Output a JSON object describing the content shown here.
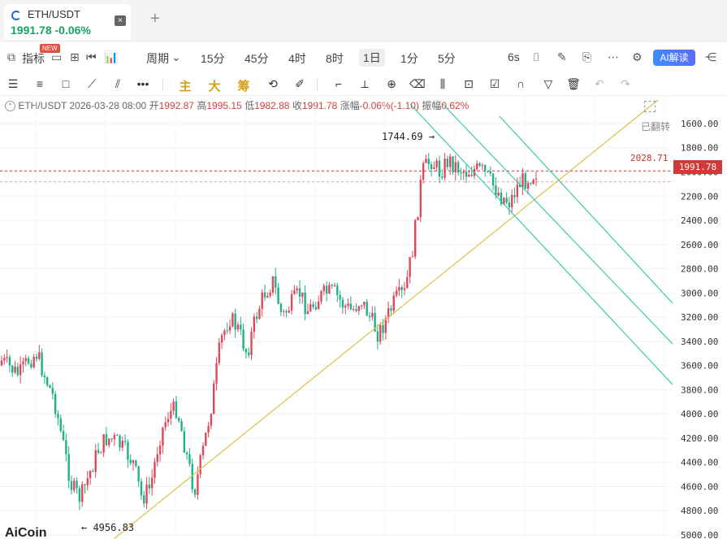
{
  "tab": {
    "symbol": "ETH/USDT",
    "price_change": "1991.78 -0.06%",
    "close": "×",
    "add": "+"
  },
  "period_bar": {
    "indicators": "指标",
    "new_badge": "NEW",
    "period": "周期",
    "intervals": [
      "15分",
      "45分",
      "4时",
      "8时",
      "1日",
      "1分",
      "5分"
    ],
    "active": "1日",
    "refresh": "6s",
    "ai": "AI解读"
  },
  "draw_bar": {
    "main": "主",
    "big": "大",
    "chips": "筹"
  },
  "info": {
    "symbol": "ETH/USDT",
    "datetime": "2026-03-28 08:00",
    "open_label": "开",
    "open": "1992.87",
    "high_label": "高",
    "high": "1995.15",
    "low_label": "低",
    "low": "1982.88",
    "close_label": "收",
    "close": "1991.78",
    "change_label": "涨幅",
    "change": "-0.06%(-1.10)",
    "amp_label": "振幅",
    "amp": "0.62%"
  },
  "chart": {
    "flip_label": "已翻转",
    "current_price": "1991.78",
    "ref_price": "2028.71",
    "top_annotation": "1744.69 →",
    "low_annotation": "← 4956.83",
    "brand": "AiCoin",
    "colors": {
      "up": "#1fb08a",
      "down": "#e0485a",
      "trend": "#d9c24a",
      "channel": "#2ec4a8",
      "price": "#d03a3a"
    }
  },
  "chart_data": {
    "type": "candlestick",
    "title": "ETH/USDT",
    "y_axis_inverted": true,
    "y_ticks": [
      "1600.00",
      "1800.00",
      "2000.00",
      "2200.00",
      "2400.00",
      "2600.00",
      "2800.00",
      "3000.00",
      "3200.00",
      "3400.00",
      "3600.00",
      "3800.00",
      "4000.00",
      "4200.00",
      "4400.00",
      "4600.00",
      "4800.00",
      "5000.00"
    ],
    "ylim": [
      1560,
      5000
    ],
    "path_close": [
      3560,
      3620,
      3680,
      3560,
      3500,
      3700,
      3880,
      4240,
      4600,
      4700,
      4500,
      4300,
      4200,
      4220,
      4300,
      4400,
      4700,
      4600,
      4200,
      4000,
      3950,
      4300,
      4640,
      4300,
      3900,
      3400,
      3200,
      3300,
      3500,
      3200,
      3000,
      2900,
      3200,
      3100,
      3000,
      3150,
      3050,
      3000,
      3000,
      3100,
      3150,
      3050,
      3200,
      3340,
      3200,
      3050,
      3000,
      2600,
      2000,
      1900,
      2000,
      1900,
      1960,
      2000,
      1980,
      2000,
      2100,
      2200,
      2250,
      2100,
      2050,
      2000
    ],
    "series": [
      {
        "name": "ETH/USDT",
        "values": []
      }
    ]
  }
}
